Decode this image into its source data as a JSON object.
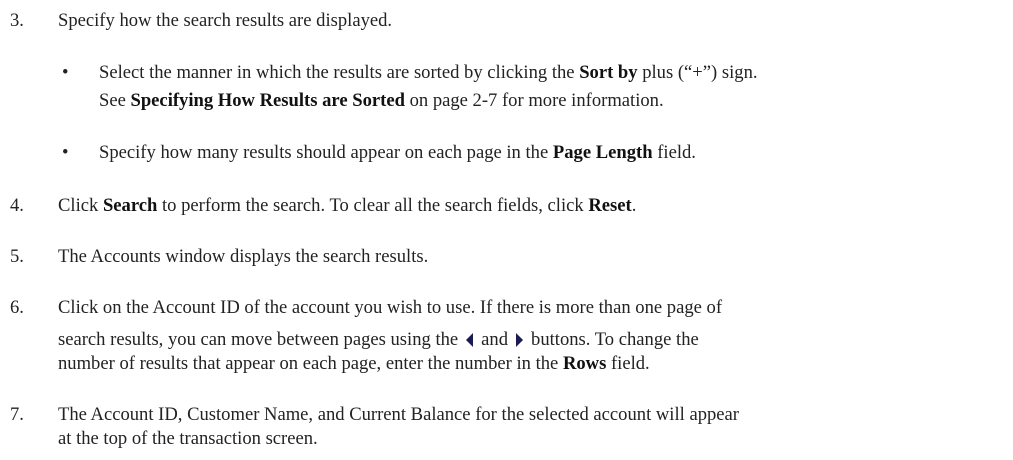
{
  "steps": [
    {
      "number": "3.",
      "text": "Specify how the search results are displayed.",
      "bullets": [
        {
          "symbol": "•",
          "part1": "Select the manner in which the results are sorted by clicking the ",
          "bold1": "Sort by",
          "part2": " plus (“+”) sign.",
          "part3": "See ",
          "bold2": "Specifying How Results are Sorted",
          "part4": " on page 2-7 for more information."
        },
        {
          "symbol": "•",
          "part1": "Specify how many results should appear on each page in the ",
          "bold1": "Page Length",
          "part2": " field."
        }
      ]
    },
    {
      "number": "4.",
      "part1": "Click ",
      "bold1": "Search",
      "part2": " to perform the search. To clear all the search fields, click ",
      "bold2": "Reset",
      "part3": "."
    },
    {
      "number": "5.",
      "text": "The Accounts window displays the search results."
    },
    {
      "number": "6.",
      "line1": "Click on the Account ID of the account you wish to use. If there is more than one page of",
      "line2a": "search results, you can move between pages using the",
      "line2b": "and",
      "line2c": "buttons. To change the",
      "line3a": "number of results that appear on each page, enter the number in the ",
      "line3bold": "Rows",
      "line3b": " field.",
      "prev_icon": "left-triangle-arrow",
      "next_icon": "right-triangle-arrow"
    },
    {
      "number": "7.",
      "line1": "The Account ID, Customer Name, and Current Balance for the selected account will appear",
      "line2": "at the top of the transaction screen."
    }
  ]
}
